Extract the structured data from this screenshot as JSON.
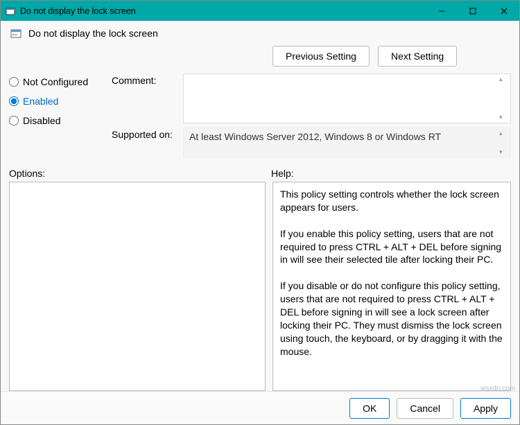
{
  "titlebar": {
    "title": "Do not display the lock screen"
  },
  "header": {
    "title": "Do not display the lock screen"
  },
  "nav": {
    "prev": "Previous Setting",
    "next": "Next Setting"
  },
  "state": {
    "not_configured": "Not Configured",
    "enabled": "Enabled",
    "disabled": "Disabled",
    "selected": "enabled"
  },
  "fields": {
    "comment_label": "Comment:",
    "comment_value": "",
    "supported_label": "Supported on:",
    "supported_value": "At least Windows Server 2012, Windows 8 or Windows RT"
  },
  "sections": {
    "options_label": "Options:",
    "help_label": "Help:"
  },
  "help_text": "This policy setting controls whether the lock screen appears for users.\n\nIf you enable this policy setting, users that are not required to press CTRL + ALT + DEL before signing in will see their selected tile after locking their PC.\n\nIf you disable or do not configure this policy setting, users that are not required to press CTRL + ALT + DEL before signing in will see a lock screen after locking their PC. They must dismiss the lock screen using touch, the keyboard, or by dragging it with the mouse.",
  "footer": {
    "ok": "OK",
    "cancel": "Cancel",
    "apply": "Apply"
  },
  "watermark": "wsxdn.com"
}
